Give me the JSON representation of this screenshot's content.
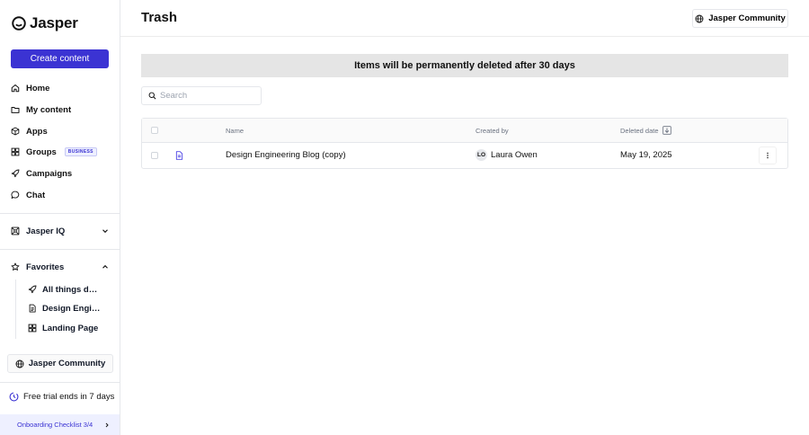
{
  "app": {
    "logo_text": "Jasper",
    "create_label": "Create content"
  },
  "sidebar": {
    "nav": [
      {
        "label": "Home",
        "icon": "home-icon"
      },
      {
        "label": "My content",
        "icon": "folder-icon"
      },
      {
        "label": "Apps",
        "icon": "cube-icon"
      },
      {
        "label": "Groups",
        "icon": "groups-icon",
        "badge": "BUSINESS"
      },
      {
        "label": "Campaigns",
        "icon": "rocket-icon"
      },
      {
        "label": "Chat",
        "icon": "chat-icon"
      }
    ],
    "iq": {
      "label": "Jasper IQ"
    },
    "favorites": {
      "label": "Favorites",
      "items": [
        {
          "label": "All things design",
          "icon": "rocket-icon"
        },
        {
          "label": "Design Engineering",
          "icon": "document-icon"
        },
        {
          "label": "Landing Page",
          "icon": "grid-icon"
        }
      ]
    },
    "community_label": "Jasper Community",
    "trial_text": "Free trial ends in 7 days",
    "onboarding_text": "Onboarding Checklist 3/4"
  },
  "header": {
    "title": "Trash",
    "community_label": "Jasper Community"
  },
  "banner": {
    "text": "Items will be permanently deleted after 30 days"
  },
  "search": {
    "placeholder": "Search",
    "value": ""
  },
  "table": {
    "columns": {
      "name": "Name",
      "created_by": "Created by",
      "deleted_date": "Deleted date"
    },
    "rows": [
      {
        "name": "Design Engineering Blog (copy)",
        "initials": "LO",
        "created_by": "Laura Owen",
        "deleted_date": "May 19, 2025"
      }
    ]
  },
  "colors": {
    "accent": "#3b33d3",
    "banner_bg": "#e5e5e5"
  }
}
